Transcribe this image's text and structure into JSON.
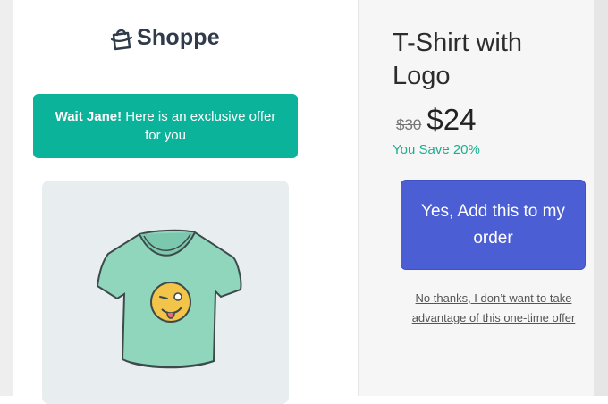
{
  "brand": {
    "name": "Shoppe",
    "icon": "shopping-bag-icon"
  },
  "banner": {
    "bold_text": "Wait Jane!",
    "rest_text": " Here is an exclusive offer for you"
  },
  "product": {
    "title": "T-Shirt with Logo",
    "old_price": "$30",
    "new_price": "$24",
    "savings": "You Save 20%",
    "image_icon": "tshirt-icon"
  },
  "actions": {
    "accept_label": "Yes, Add this to my order",
    "decline_label": "No thanks, I don’t want to take advantage of this one-time offer"
  },
  "colors": {
    "banner": "#0bb39b",
    "accept_button": "#4b5ed3",
    "savings_text": "#1cae8f"
  }
}
